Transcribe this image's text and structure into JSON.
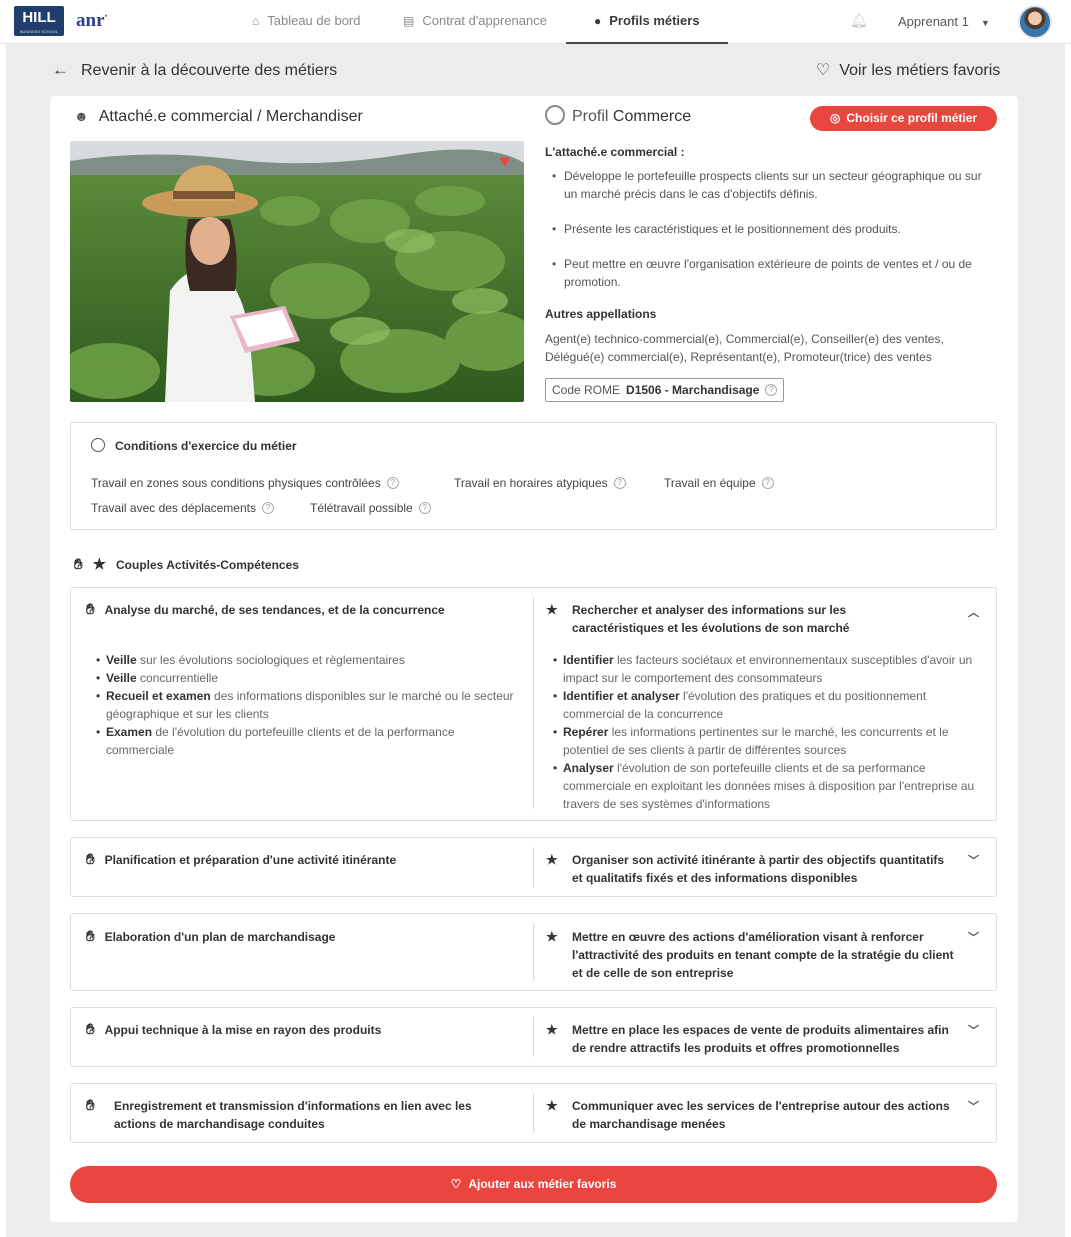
{
  "brand": {
    "hill": "HILL",
    "hill_sub": "BUSINESS SCHOOL",
    "anr": "anr"
  },
  "nav": {
    "tabs": [
      {
        "label": "Tableau de bord",
        "icon": "home-icon"
      },
      {
        "label": "Contrat d'apprenance",
        "icon": "document-icon"
      },
      {
        "label": "Profils métiers",
        "icon": "profile-icon",
        "active": true
      }
    ],
    "user_label": "Apprenant 1"
  },
  "header": {
    "back_label": "Revenir à la découverte des métiers",
    "favorites_label": "Voir les métiers favoris"
  },
  "job": {
    "title": "Attaché.e commercial / Merchandiser",
    "profile_prefix": "Profil",
    "profile_name": "Commerce",
    "choose_label": "Choisir ce profil métier",
    "desc_heading": "L'attaché.e commercial :",
    "desc_items": [
      "Développe le portefeuille prospects clients sur un secteur géographique ou sur un marché précis dans le cas d'objectifs définis.",
      "Présente les caractéristiques et le positionnement des produits.",
      "Peut mettre en œuvre l'organisation extérieure de points de ventes et / ou de promotion."
    ],
    "autres_heading": "Autres appellations",
    "autres_text": "Agent(e) technico-commercial(e), Commercial(e), Conseiller(e) des ventes, Délégué(e) commercial(e), Représentant(e), Promoteur(trice) des ventes",
    "rome_label": "Code ROME",
    "rome_value": "D1506 - Marchandisage"
  },
  "conditions": {
    "title": "Conditions d'exercice du métier",
    "items": [
      "Travail en zones sous conditions physiques contrôlées",
      "Travail en horaires atypiques",
      "Travail en équipe",
      "Travail avec des déplacements",
      "Télétravail possible"
    ]
  },
  "couples": {
    "title": "Couples Activités-Compétences",
    "expanded": {
      "activity": "Analyse du marché, de ses tendances, et de la concurrence",
      "competence": "Rechercher et analyser des informations sur les caractéristiques et les évolutions de son marché",
      "left_items": [
        {
          "strong": "Veille",
          "text": " sur les évolutions sociologiques et règlementaires"
        },
        {
          "strong": "Veille",
          "text": " concurrentielle"
        },
        {
          "strong": "Recueil et examen",
          "text": " des informations disponibles sur le marché ou le secteur géographique et sur les clients"
        },
        {
          "strong": "Examen",
          "text": " de l'évolution du portefeuille clients et de la performance commerciale"
        }
      ],
      "right_items": [
        {
          "strong": "Identifier",
          "text": " les facteurs sociétaux et environnementaux susceptibles d'avoir un impact sur le comportement des consommateurs"
        },
        {
          "strong": "Identifier et analyser",
          "text": " l'évolution des pratiques et du positionnement commercial de la concurrence"
        },
        {
          "strong": "Repérer",
          "text": " les informations pertinentes sur le marché, les concurrents et le potentiel de ses clients à partir de différentes sources"
        },
        {
          "strong": "Analyser",
          "text": " l'évolution de son portefeuille clients et de sa performance commerciale en exploitant les données mises à disposition par l'entreprise au travers de ses systèmes d'informations"
        }
      ]
    },
    "rows": [
      {
        "activity": "Planification et préparation d'une activité itinérante",
        "competence": "Organiser son activité itinérante à partir des objectifs quantitatifs et qualitatifs fixés et des informations disponibles"
      },
      {
        "activity": "Elaboration d'un plan de marchandisage",
        "competence": "Mettre en œuvre des actions d'amélioration visant à renforcer l'attractivité des produits en tenant compte de la stratégie du client et de celle de son entreprise"
      },
      {
        "activity": "Appui technique à la mise en rayon des produits",
        "competence": "Mettre en place les espaces de vente de produits alimentaires afin de rendre attractifs les produits et offres promotionnelles"
      },
      {
        "activity": "Enregistrement et transmission d'informations en lien avec les actions de marchandisage conduites",
        "competence": "Communiquer avec les services de l'entreprise autour des actions de marchandisage menées"
      }
    ]
  },
  "footer": {
    "add_favorite_label": "Ajouter aux métier favoris"
  },
  "colors": {
    "accent": "#e8463f",
    "brand_navy": "#1f3e6b",
    "background": "#ececec"
  }
}
